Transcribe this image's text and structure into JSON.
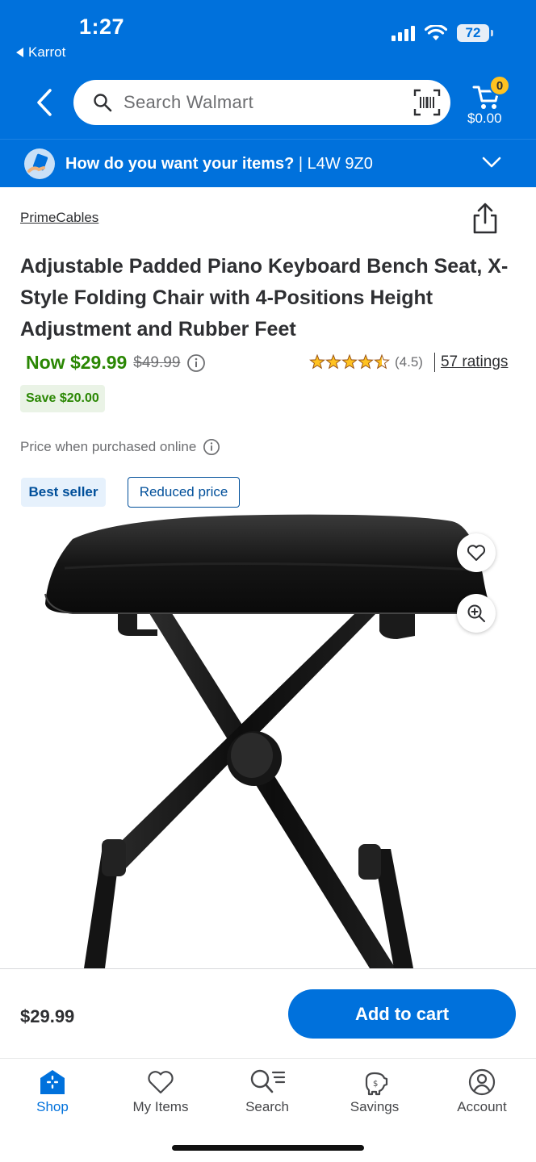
{
  "status_bar": {
    "time": "1:27",
    "back_app": "Karrot",
    "battery": "72"
  },
  "header": {
    "search_placeholder": "Search Walmart",
    "cart_count": "0",
    "cart_total": "$0.00",
    "delivery_prompt": "How do you want your items?",
    "delivery_location": " | L4W 9Z0"
  },
  "product": {
    "brand": "PrimeCables",
    "title": "Adjustable Padded Piano Keyboard Bench Seat, X-Style Folding Chair with 4-Positions Height Adjustment and Rubber Feet",
    "now_price": "Now $29.99",
    "was_price": "$49.99",
    "rating_value": "(4.5)",
    "rating_stars": 4.5,
    "ratings_count": "57 ratings",
    "save_badge": "Save $20.00",
    "purchase_note": "Price when purchased online",
    "tags": [
      "Best seller",
      "Reduced price"
    ]
  },
  "buybar": {
    "price": "$29.99",
    "add_label": "Add to cart"
  },
  "tabs": [
    {
      "label": "Shop",
      "icon": "shop-icon",
      "active": true
    },
    {
      "label": "My Items",
      "icon": "heart-icon",
      "active": false
    },
    {
      "label": "Search",
      "icon": "search-list-icon",
      "active": false
    },
    {
      "label": "Savings",
      "icon": "savings-icon",
      "active": false
    },
    {
      "label": "Account",
      "icon": "account-icon",
      "active": false
    }
  ],
  "colors": {
    "brand_blue": "#0071dc",
    "price_green": "#2a8703",
    "star_yellow": "#ffc220",
    "badge_blue": "#004f9a"
  }
}
